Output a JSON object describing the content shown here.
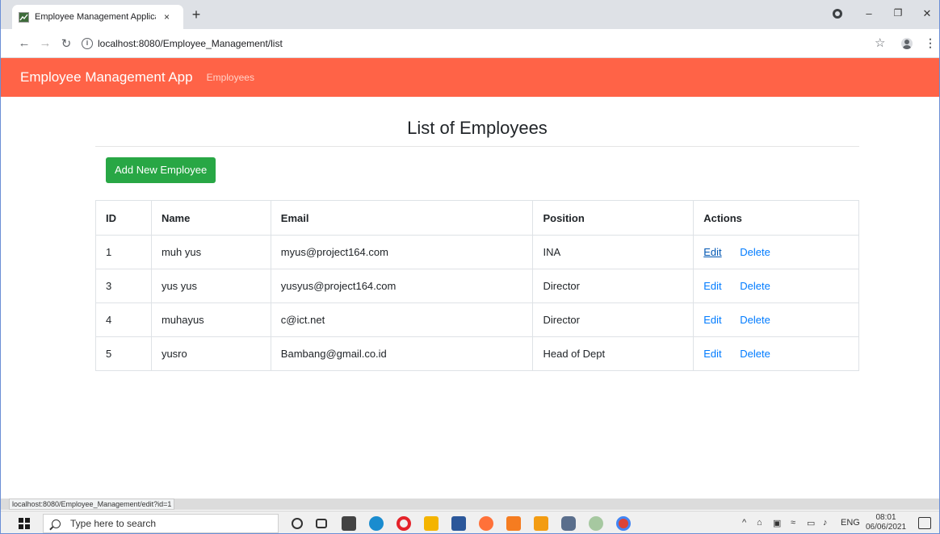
{
  "browser": {
    "tab_title": "Employee Management Applicat",
    "tab_close": "×",
    "new_tab": "+",
    "url": "localhost:8080/Employee_Management/list",
    "window_controls": {
      "minimize": "–",
      "maximize": "❐",
      "close": "✕"
    }
  },
  "app": {
    "brand": "Employee Management App",
    "nav_link": "Employees",
    "header_color": "#ff6347"
  },
  "page": {
    "title": "List of Employees",
    "add_button": "Add New Employee",
    "add_button_color": "#28a745"
  },
  "table": {
    "headers": [
      "ID",
      "Name",
      "Email",
      "Position",
      "Actions"
    ],
    "rows": [
      {
        "id": "1",
        "name": "muh yus",
        "email": "myus@project164.com",
        "position": "INA",
        "edit": "Edit",
        "delete": "Delete"
      },
      {
        "id": "3",
        "name": "yus yus",
        "email": "yusyus@project164.com",
        "position": "Director",
        "edit": "Edit",
        "delete": "Delete"
      },
      {
        "id": "4",
        "name": "muhayus",
        "email": "c@ict.net",
        "position": "Director",
        "edit": "Edit",
        "delete": "Delete"
      },
      {
        "id": "5",
        "name": "yusro",
        "email": "Bambang@gmail.co.id",
        "position": "Head of Dept",
        "edit": "Edit",
        "delete": "Delete"
      }
    ],
    "link_color": "#007bff"
  },
  "status_bar": {
    "hover_url": "localhost:8080/Employee_Management/edit?id=1"
  },
  "taskbar": {
    "search_placeholder": "Type here to search",
    "language": "ENG",
    "time": "08:01",
    "date": "06/06/2021"
  }
}
